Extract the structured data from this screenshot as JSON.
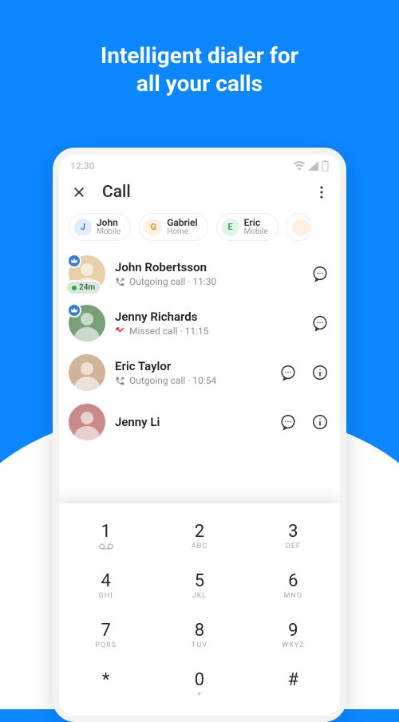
{
  "headline_line1": "Intelligent dialer for",
  "headline_line2": "all your calls",
  "statusbar": {
    "time": "12:30"
  },
  "header": {
    "title": "Call"
  },
  "chips": [
    {
      "initial": "J",
      "bg": "#e3edff",
      "fg": "#3a7bd5",
      "name": "John",
      "sub": "Mobile"
    },
    {
      "initial": "G",
      "bg": "#fff0e0",
      "fg": "#d78b2a",
      "name": "Gabriel",
      "sub": "Home"
    },
    {
      "initial": "E",
      "bg": "#e2f5ea",
      "fg": "#2f9e5b",
      "name": "Eric",
      "sub": "Mobile"
    }
  ],
  "calls": [
    {
      "name": "John Robertsson",
      "status_label": "Outgoing call",
      "time": "11:30",
      "type": "outgoing",
      "avatar_bg": "#e8cfa8",
      "has_crown": true,
      "pill": "24m",
      "actions": [
        "message"
      ]
    },
    {
      "name": "Jenny Richards",
      "status_label": "Missed call",
      "time": "11:15",
      "type": "missed",
      "avatar_bg": "#7aa07a",
      "has_crown": true,
      "actions": [
        "message"
      ]
    },
    {
      "name": "Eric Taylor",
      "status_label": "Outgoing call",
      "time": "10:54",
      "type": "outgoing",
      "avatar_bg": "#d0b49a",
      "has_crown": false,
      "actions": [
        "message",
        "info"
      ]
    },
    {
      "name": "Jenny Li",
      "status_label": "",
      "time": "",
      "type": "",
      "avatar_bg": "#c98a8a",
      "has_crown": false,
      "actions": [
        "message",
        "info"
      ],
      "partial": true
    }
  ],
  "dialpad": [
    {
      "d": "1",
      "s": "vm"
    },
    {
      "d": "2",
      "s": "ABC"
    },
    {
      "d": "3",
      "s": "DEF"
    },
    {
      "d": "4",
      "s": "GHI"
    },
    {
      "d": "5",
      "s": "JKL"
    },
    {
      "d": "6",
      "s": "MNO"
    },
    {
      "d": "7",
      "s": "PQRS"
    },
    {
      "d": "8",
      "s": "TUV"
    },
    {
      "d": "9",
      "s": "WXYZ"
    },
    {
      "d": "*",
      "s": ""
    },
    {
      "d": "0",
      "s": "+"
    },
    {
      "d": "#",
      "s": ""
    }
  ]
}
